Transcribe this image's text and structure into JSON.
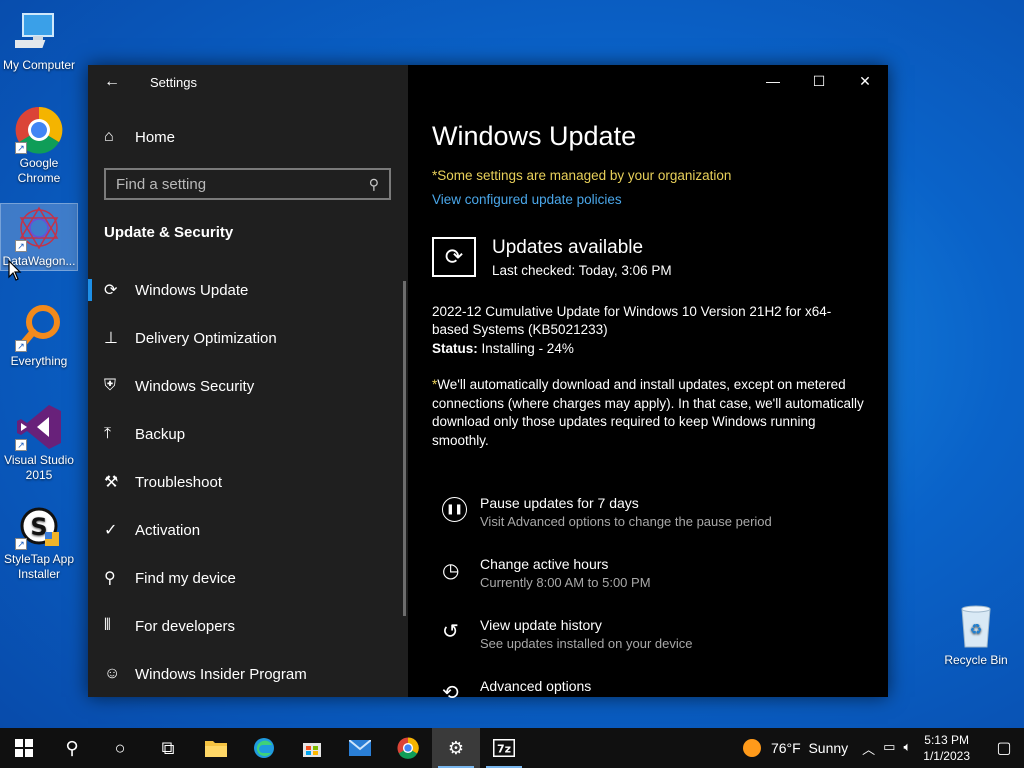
{
  "desktop": {
    "icons": [
      {
        "label": "My Computer"
      },
      {
        "label": "Google Chrome"
      },
      {
        "label": "DataWagon..."
      },
      {
        "label": "Everything"
      },
      {
        "label": "Visual Studio 2015"
      },
      {
        "label": "StyleTap App Installer"
      },
      {
        "label": "Recycle Bin"
      }
    ]
  },
  "window": {
    "app_title": "Settings",
    "home_label": "Home",
    "search_placeholder": "Find a setting",
    "section_title": "Update & Security",
    "nav_items": [
      {
        "label": "Windows Update",
        "icon": "refresh-icon"
      },
      {
        "label": "Delivery Optimization",
        "icon": "delivery-icon"
      },
      {
        "label": "Windows Security",
        "icon": "shield-icon"
      },
      {
        "label": "Backup",
        "icon": "backup-icon"
      },
      {
        "label": "Troubleshoot",
        "icon": "wrench-icon"
      },
      {
        "label": "Activation",
        "icon": "checkmark-circle-icon"
      },
      {
        "label": "Find my device",
        "icon": "person-pin-icon"
      },
      {
        "label": "For developers",
        "icon": "developer-sliders-icon"
      },
      {
        "label": "Windows Insider Program",
        "icon": "insider-cat-icon"
      }
    ]
  },
  "main": {
    "title": "Windows Update",
    "managed_notice": "*Some settings are managed by your organization",
    "policies_link": "View configured update policies",
    "status_title": "Updates available",
    "last_checked": "Last checked: Today, 3:06 PM",
    "update_name": "2022-12 Cumulative Update for Windows 10 Version 21H2 for x64-based Systems (KB5021233)",
    "status_label": "Status:",
    "status_value": "Installing - 24%",
    "notice_star": "*",
    "notice_text": "We'll automatically download and install updates, except on metered connections (where charges may apply). In that case, we'll automatically download only those updates required to keep Windows running smoothly.",
    "options": [
      {
        "title": "Pause updates for 7 days",
        "subtitle": "Visit Advanced options to change the pause period"
      },
      {
        "title": "Change active hours",
        "subtitle": "Currently 8:00 AM to 5:00 PM"
      },
      {
        "title": "View update history",
        "subtitle": "See updates installed on your device"
      },
      {
        "title": "Advanced options",
        "subtitle": ""
      }
    ]
  },
  "taskbar": {
    "weather_temp": "76°F",
    "weather_desc": "Sunny",
    "time": "5:13 PM",
    "date": "1/1/2023"
  },
  "colors": {
    "accent": "#1d8fe6",
    "managed": "#e8d05a",
    "link": "#4aa7ea"
  }
}
